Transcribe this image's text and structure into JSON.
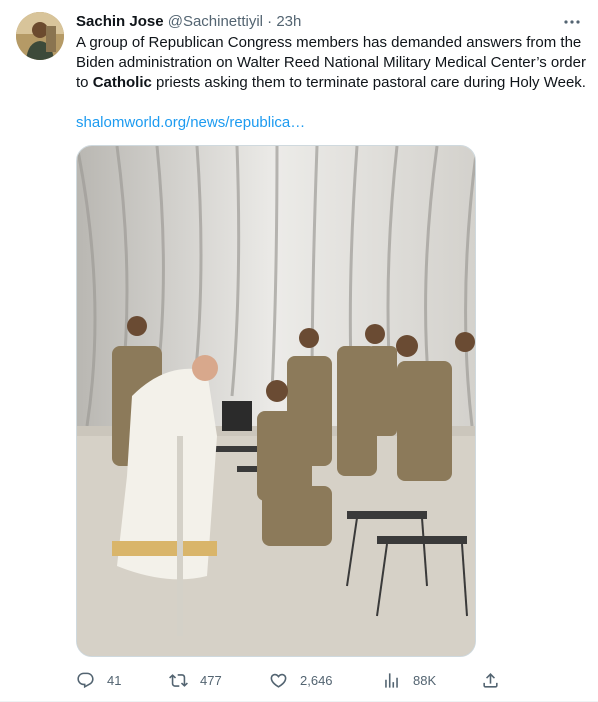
{
  "tweet": {
    "author_name": "Sachin Jose",
    "handle": "@Sachinettiyil",
    "separator": "·",
    "time": "23h",
    "more_icon": "more-dots-icon",
    "text_part1": "A group of Republican Congress members has demanded answers from the Biden administration on Walter Reed National Military Medical Center’s order to ",
    "text_bold": "Catholic",
    "text_part2": " priests asking them to terminate pastoral care during Holy Week.",
    "link_text": "shalomworld.org/news/republica…"
  },
  "actions": {
    "reply_count": "41",
    "retweet_count": "477",
    "like_count": "2,646",
    "views_count": "88K"
  },
  "colors": {
    "link": "#1d9bf0",
    "secondary_text": "#536471",
    "border": "#cfd9de"
  }
}
